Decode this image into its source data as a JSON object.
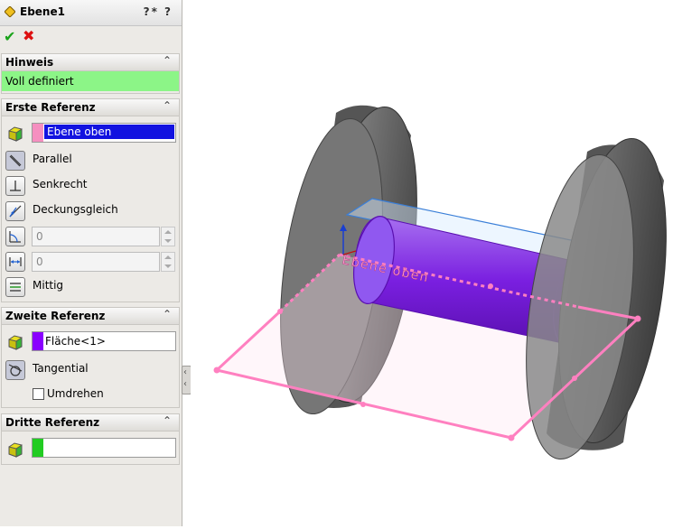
{
  "window": {
    "title": "Ebene1",
    "help_label": "?* ?"
  },
  "actions": {
    "ok_label": "✔",
    "cancel_label": "✖"
  },
  "hint": {
    "title": "Hinweis",
    "collapse": "⌃",
    "status": "Voll definiert",
    "status_color": "#8cf587"
  },
  "first_ref": {
    "title": "Erste Referenz",
    "collapse": "⌃",
    "selection": "Ebene oben",
    "swatch_color": "#f58fc0",
    "options": [
      "Parallel",
      "Senkrecht",
      "Deckungsgleich",
      "Mittig"
    ],
    "angle_value": "0",
    "distance_value": "0"
  },
  "second_ref": {
    "title": "Zweite Referenz",
    "collapse": "⌃",
    "selection": "Fläche<1>",
    "swatch_color": "#8a00ff",
    "options": [
      "Tangential"
    ],
    "flip_label": "Umdrehen"
  },
  "third_ref": {
    "title": "Dritte Referenz",
    "collapse": "⌃",
    "selection": "",
    "swatch_color": "#22cc22"
  },
  "viewport": {
    "plane_label": "Ebene oben",
    "plane_color": "#ff80c0",
    "cylinder_color": "#7a1fe0",
    "wheel_color": "#6e6e6e"
  }
}
